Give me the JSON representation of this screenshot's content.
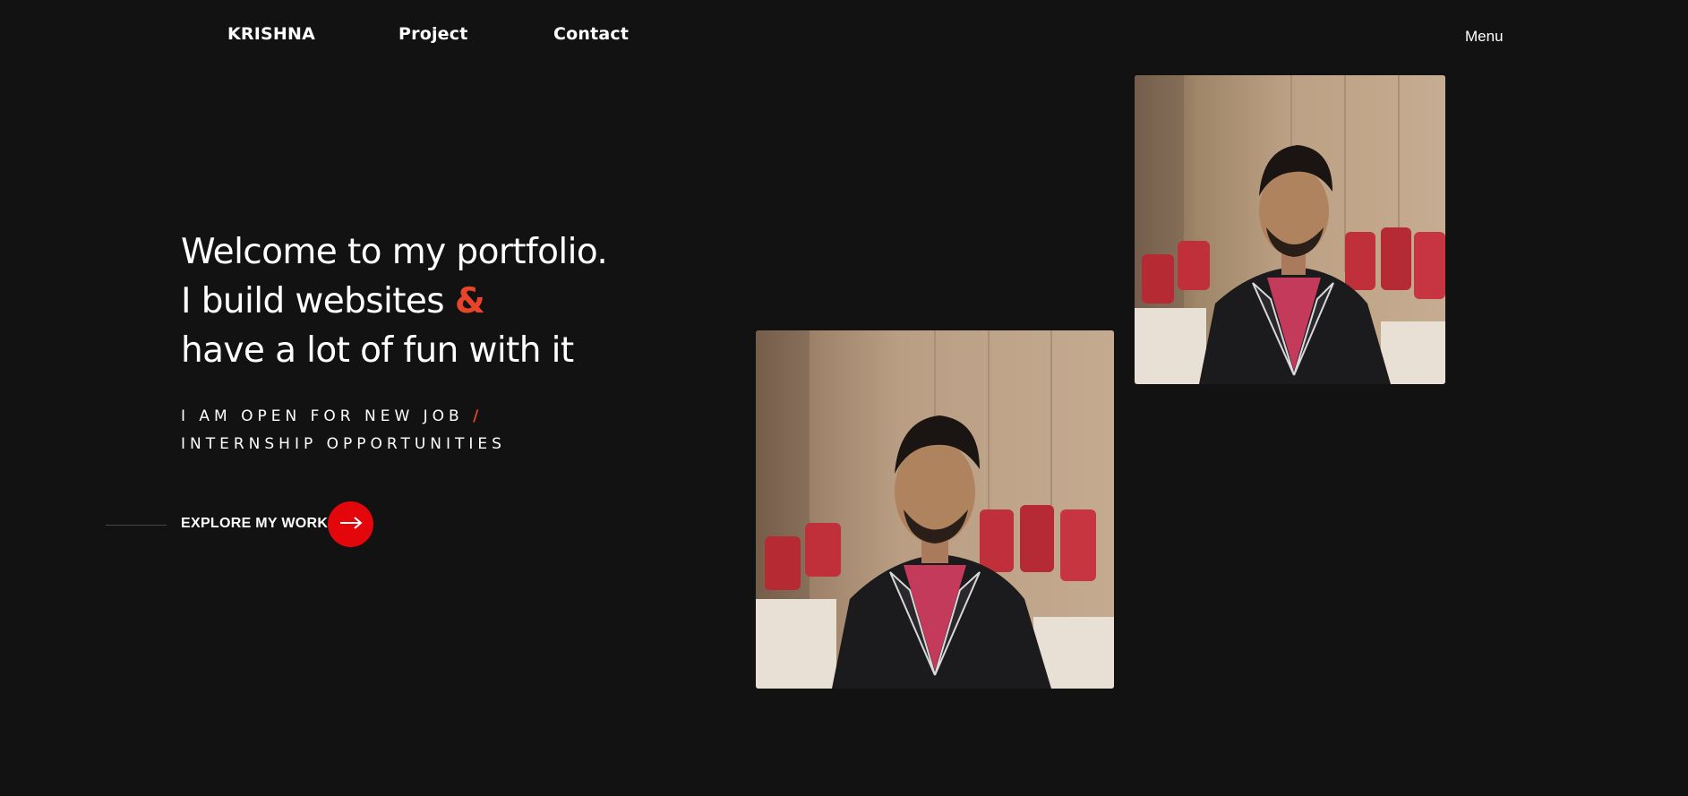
{
  "nav": {
    "brand": "KRISHNA",
    "project": "Project",
    "contact": "Contact",
    "menu": "Menu"
  },
  "hero": {
    "line1": "Welcome to my portfolio.",
    "line2_text": "I build websites",
    "line2_accent": "&",
    "line3": "have a lot of fun with it"
  },
  "subtitle": {
    "line1": "I AM OPEN FOR NEW JOB",
    "separator": "/",
    "line2": "INTERNSHIP OPPORTUNITIES"
  },
  "cta": {
    "label": "EXPLORE MY WORK",
    "arrow_icon": "arrow-right-icon"
  },
  "colors": {
    "background": "#121212",
    "accent": "#e8442a",
    "cta_red": "#e3060b",
    "text": "#ffffff"
  },
  "images": {
    "portrait": "portrait-photo"
  }
}
